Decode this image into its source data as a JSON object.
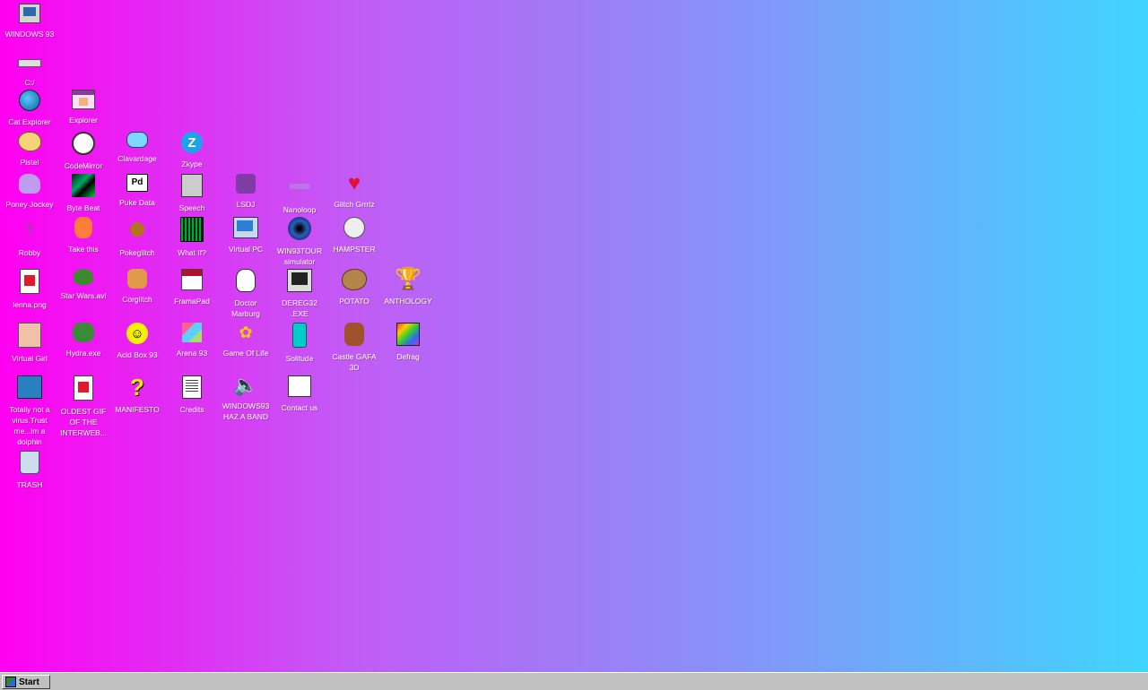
{
  "desktop": {
    "icons": [
      {
        "label": "WINDOWS 93",
        "icon": "computer-icon"
      },
      {
        "label": "C:/",
        "icon": "drive-icon"
      },
      {
        "label": "Cat Explorer",
        "icon": "globe-icon"
      },
      {
        "label": "Explorer",
        "icon": "window-icon"
      },
      {
        "label": "Pistel",
        "icon": "palette-icon"
      },
      {
        "label": "CodeMirror",
        "icon": "codemirror-icon"
      },
      {
        "label": "Clavardage",
        "icon": "chat-bubble-icon"
      },
      {
        "label": "Zkype",
        "icon": "zkype-icon"
      },
      {
        "label": "Poney Jockey",
        "icon": "pony-icon"
      },
      {
        "label": "Byte Beat",
        "icon": "bytebeat-icon"
      },
      {
        "label": "Puke Data",
        "icon": "puredata-icon"
      },
      {
        "label": "Speech",
        "icon": "speech-icon"
      },
      {
        "label": "LSDJ",
        "icon": "lsdj-icon"
      },
      {
        "label": "Nanoloop",
        "icon": "nanoloop-icon"
      },
      {
        "label": "Glitch Grrrlz",
        "icon": "heart-icon"
      },
      {
        "label": "Robby",
        "icon": "stickman-icon"
      },
      {
        "label": "Take this",
        "icon": "baby-icon"
      },
      {
        "label": "Pokeglitch",
        "icon": "pokeball-icon"
      },
      {
        "label": "What If?",
        "icon": "matrix-icon"
      },
      {
        "label": "Virtual PC",
        "icon": "virtual-pc-icon"
      },
      {
        "label": "WIN93TOUR\nsimulator",
        "icon": "vortex-icon"
      },
      {
        "label": "HAMPSTER",
        "icon": "hamster-icon"
      },
      {
        "label": "lenna.png",
        "icon": "image-file-icon"
      },
      {
        "label": "Star Wars.avi",
        "icon": "yoda-icon"
      },
      {
        "label": "Corglitch",
        "icon": "corgi-icon"
      },
      {
        "label": "FramaPad",
        "icon": "framapad-icon"
      },
      {
        "label": "Doctor\nMarburg",
        "icon": "doctor-icon"
      },
      {
        "label": "DEREG32\n.EXE",
        "icon": "monitor-icon"
      },
      {
        "label": "POTATO",
        "icon": "potato-icon"
      },
      {
        "label": "ANTHOLOGY",
        "icon": "trophy-icon"
      },
      {
        "label": "Virtual Girl",
        "icon": "face-icon"
      },
      {
        "label": "Hydra.exe",
        "icon": "hydra-icon"
      },
      {
        "label": "Acid Box 93",
        "icon": "smiley-icon"
      },
      {
        "label": "Arena 93",
        "icon": "cube-icon"
      },
      {
        "label": "Game Of Life",
        "icon": "game-of-life-icon"
      },
      {
        "label": "Solitude",
        "icon": "bottle-icon"
      },
      {
        "label": "Castle GAFA\n3D",
        "icon": "castle-icon"
      },
      {
        "label": "Defrag",
        "icon": "defrag-icon"
      },
      {
        "label": "Totally not a\nvirus.Trust\nme...im a\ndolphin",
        "icon": "dolphin-icon"
      },
      {
        "label": "OLDEST GIF\nOF THE\nINTERWEB...",
        "icon": "gif-file-icon"
      },
      {
        "label": "MANIFESTO",
        "icon": "question-mark-icon"
      },
      {
        "label": "Credits",
        "icon": "text-file-icon"
      },
      {
        "label": "WINDOWS93\nHAZ A BAND",
        "icon": "speaker-icon"
      },
      {
        "label": "Contact us",
        "icon": "contact-icon"
      },
      {
        "label": "TRASH",
        "icon": "trash-icon"
      }
    ]
  },
  "taskbar": {
    "start_label": "Start"
  }
}
